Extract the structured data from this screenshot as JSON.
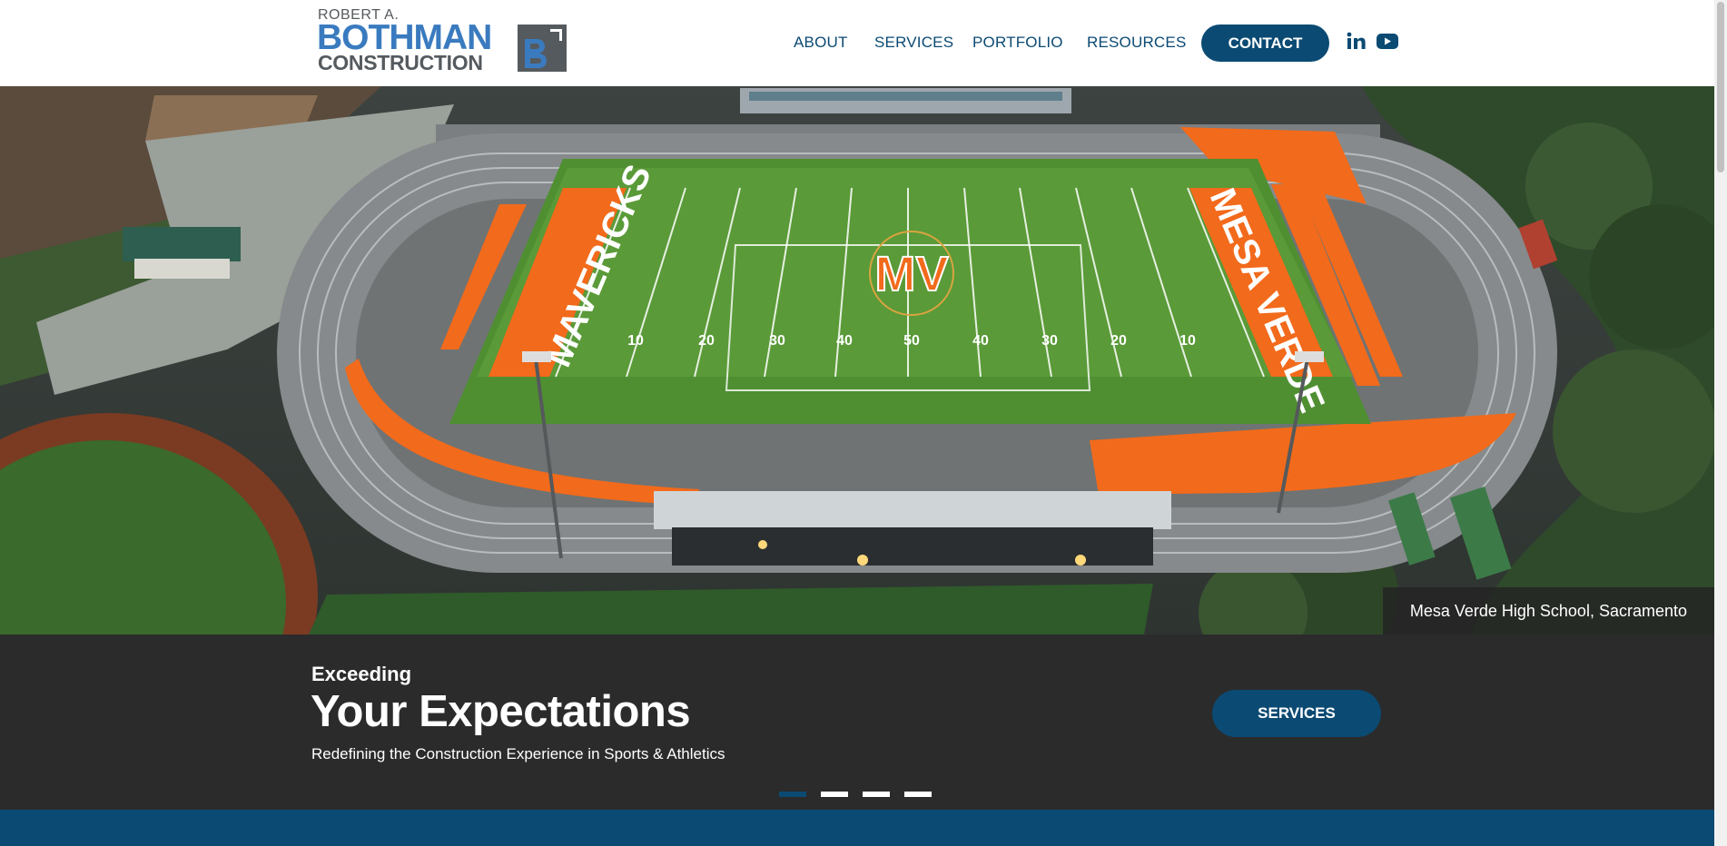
{
  "header": {
    "logo": {
      "line1": "ROBERT A.",
      "line2": "BOTHMAN",
      "line3": "CONSTRUCTION",
      "mark_letter": "B"
    },
    "nav": [
      {
        "label": "ABOUT"
      },
      {
        "label": "SERVICES"
      },
      {
        "label": "PORTFOLIO"
      },
      {
        "label": "RESOURCES"
      }
    ],
    "contact_label": "CONTACT",
    "social": [
      "linkedin-icon",
      "youtube-icon"
    ]
  },
  "hero": {
    "caption": "Mesa Verde High School, Sacramento",
    "endzone_left": "MAVERICKS",
    "endzone_right": "MESA VERDE",
    "yard_numbers": [
      "10",
      "20",
      "30",
      "40",
      "50",
      "40",
      "30",
      "20",
      "10"
    ],
    "midfield_logo": "MV"
  },
  "band": {
    "kicker": "Exceeding",
    "headline": "Your Expectations",
    "subline": "Redefining the Construction Experience in Sports & Athletics",
    "button_label": "SERVICES",
    "slides": 4,
    "active_slide": 0
  },
  "colors": {
    "brand_blue": "#0b4a73",
    "logo_blue": "#3a7bbf",
    "logo_gray": "#555a5e",
    "turf": "#4f8f32",
    "track_orange": "#f26a1b"
  }
}
